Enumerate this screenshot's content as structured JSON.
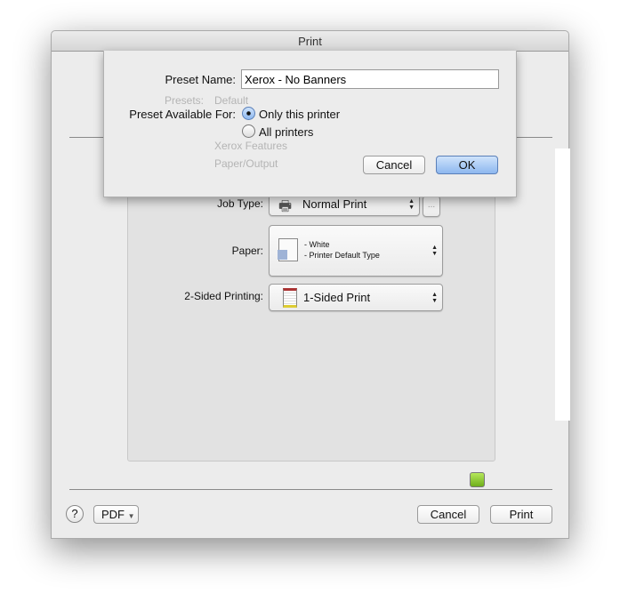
{
  "window": {
    "title": "Print"
  },
  "background": {
    "presets_label": "Presets:",
    "presets_value": "Default",
    "features_value": "Xerox Features",
    "section_value": "Paper/Output"
  },
  "options": {
    "job_type_label": "Job Type:",
    "job_type_value": "Normal Print",
    "more_button": "...",
    "paper_label": "Paper:",
    "paper_line1": "- White",
    "paper_line2": "- Printer Default Type",
    "two_sided_label": "2-Sided Printing:",
    "two_sided_value": "1-Sided Print"
  },
  "footer": {
    "help": "?",
    "pdf": "PDF",
    "pdf_arrow": "▼",
    "cancel": "Cancel",
    "print": "Print",
    "status_color": "#8fd02a"
  },
  "sheet": {
    "preset_name_label": "Preset Name:",
    "preset_name_value": "Xerox - No Banners",
    "available_label": "Preset Available For:",
    "radio_options": [
      {
        "label": "Only this printer",
        "selected": true
      },
      {
        "label": "All printers",
        "selected": false
      }
    ],
    "cancel": "Cancel",
    "ok": "OK",
    "accent": "#8db7ef"
  }
}
